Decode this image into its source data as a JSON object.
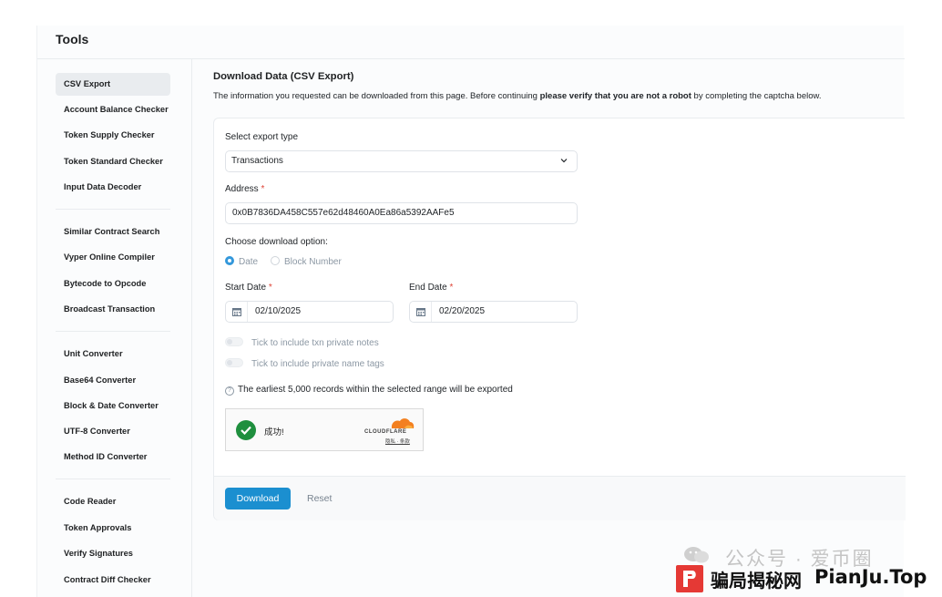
{
  "panel": {
    "title": "Tools"
  },
  "sidebar": {
    "items": [
      {
        "label": "CSV Export",
        "active": true
      },
      {
        "label": "Account Balance Checker"
      },
      {
        "label": "Token Supply Checker"
      },
      {
        "label": "Token Standard Checker"
      },
      {
        "label": "Input Data Decoder"
      },
      {
        "label": "Similar Contract Search"
      },
      {
        "label": "Vyper Online Compiler"
      },
      {
        "label": "Bytecode to Opcode"
      },
      {
        "label": "Broadcast Transaction"
      },
      {
        "label": "Unit Converter"
      },
      {
        "label": "Base64 Converter"
      },
      {
        "label": "Block & Date Converter"
      },
      {
        "label": "UTF-8 Converter"
      },
      {
        "label": "Method ID Converter"
      },
      {
        "label": "Code Reader"
      },
      {
        "label": "Token Approvals"
      },
      {
        "label": "Verify Signatures"
      },
      {
        "label": "Contract Diff Checker"
      }
    ]
  },
  "main": {
    "title": "Download Data (CSV Export)",
    "desc_prefix": "The information you requested can be downloaded from this page. Before continuing ",
    "desc_bold": "please verify that you are not a robot",
    "desc_suffix": " by completing the captcha below."
  },
  "form": {
    "export_type_label": "Select export type",
    "export_type_value": "Transactions",
    "address_label": "Address",
    "required_mark": "*",
    "address_value": "0x0B7836DA458C557e62d48460A0Ea86a5392AAFe5",
    "download_option_label": "Choose download option:",
    "option_date": "Date",
    "option_block": "Block Number",
    "start_date_label": "Start Date",
    "start_date_value": "02/10/2025",
    "end_date_label": "End Date",
    "end_date_value": "02/20/2025",
    "toggle_notes": "Tick to include txn private notes",
    "toggle_tags": "Tick to include private name tags",
    "note": "The earliest 5,000 records within the selected range will be exported"
  },
  "captcha": {
    "status": "成功!",
    "brand": "CLOUDFLARE",
    "links": "隐私 · 条款",
    "accent": "#f38020"
  },
  "actions": {
    "download_label": "Download",
    "reset_label": "Reset"
  },
  "watermark": {
    "top_text": "公众号 · 爱币圈",
    "cn_text": "骗局揭秘网",
    "en_text": "PianJu.Top"
  },
  "colors": {
    "primary": "#1b8fd0",
    "required": "#de4437",
    "success": "#1f8f3e"
  }
}
